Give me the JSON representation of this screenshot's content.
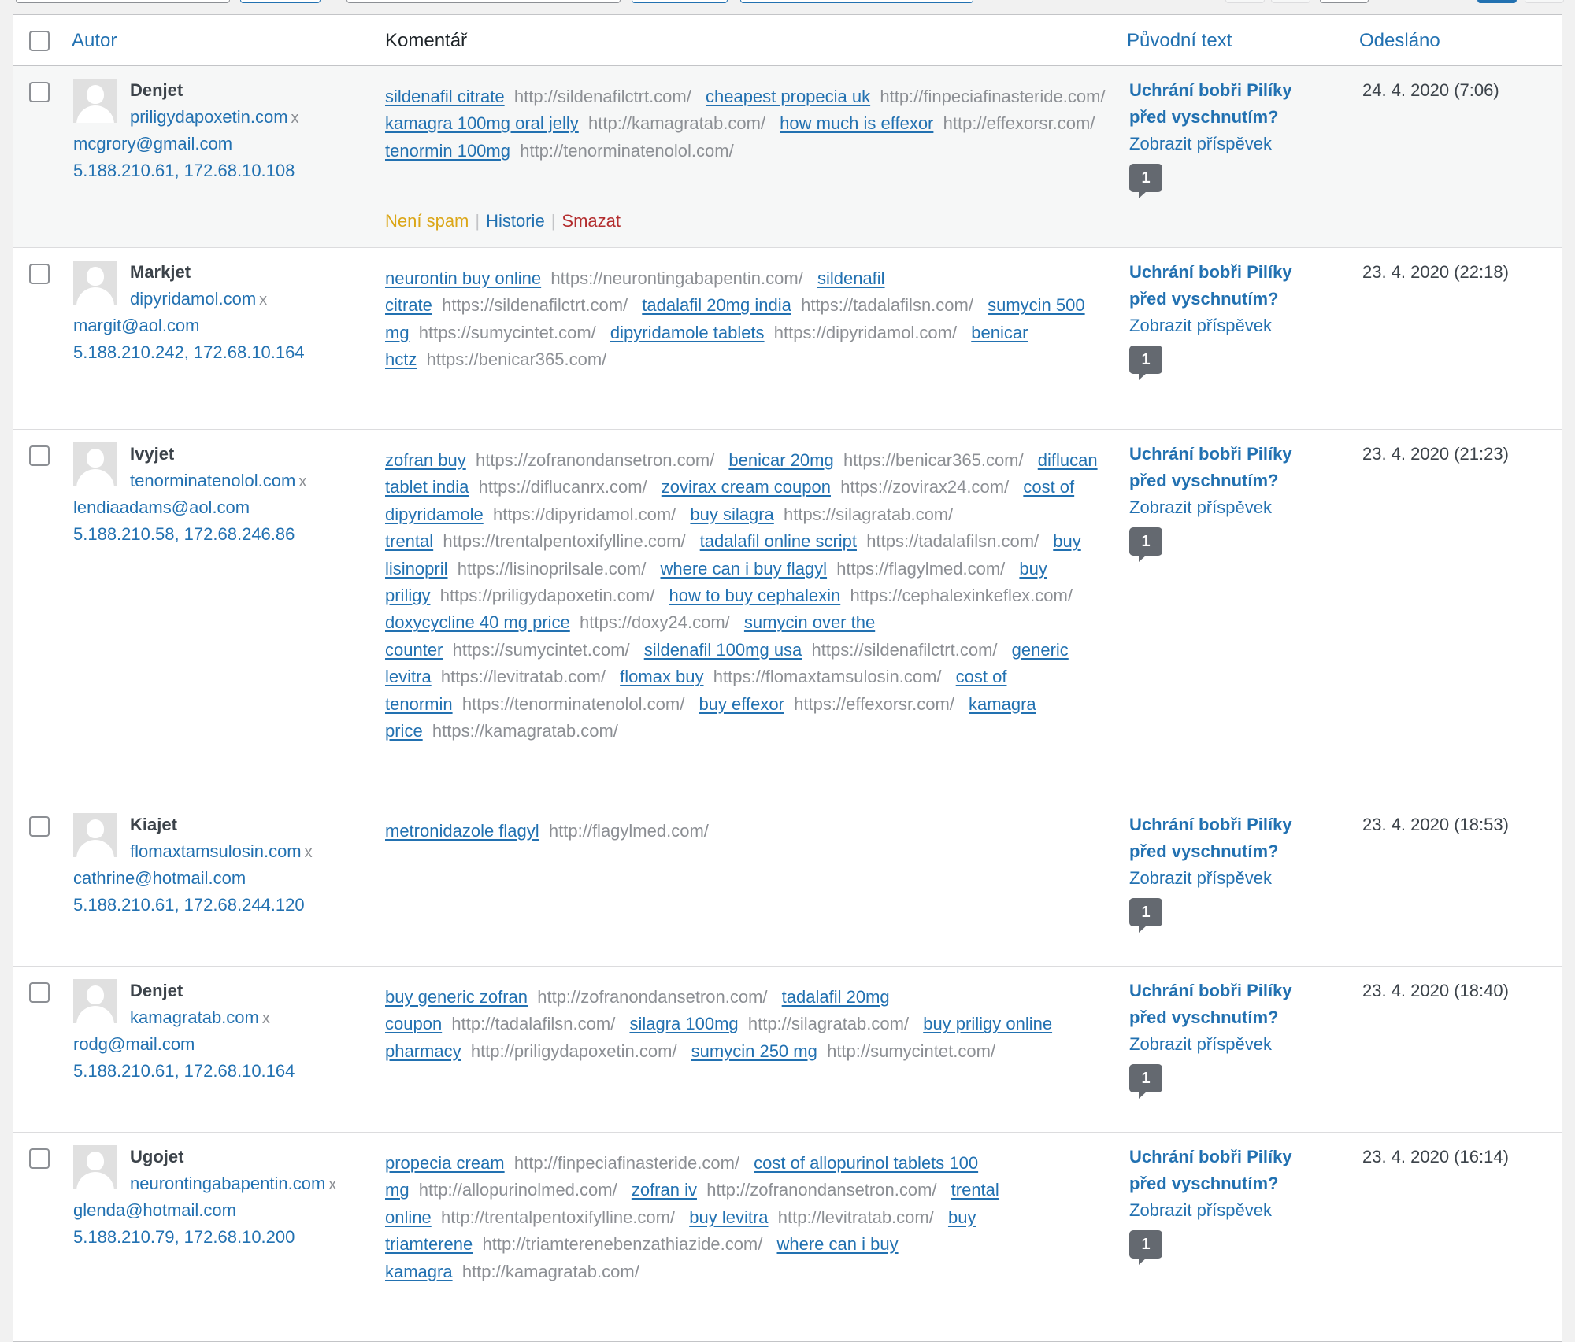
{
  "header": {
    "author": "Autor",
    "comment": "Komentář",
    "response": "Původní text",
    "submitted": "Odesláno"
  },
  "colors": {
    "link": "#2271b1",
    "not_spam": "#dba617",
    "delete": "#b32d2e",
    "url_text": "#8c8f94",
    "spam_row_bg": "#f6f7f7"
  },
  "rows": [
    {
      "name": "Denjet",
      "site": "priligydapoxetin.com",
      "email": "mcgrory@gmail.com",
      "ip": "5.188.210.61, 172.68.10.108",
      "post": "Uchrání bobři Pilíky před vyschnutím?",
      "view": "Zobrazit příspěvek",
      "count": "1",
      "date": "24. 4. 2020 (7:06)",
      "actions": {
        "not_spam": "Není spam",
        "history": "Historie",
        "delete": "Smazat"
      },
      "segments": [
        {
          "t": "sildenafil citrate",
          "u": "http://sildenafilctrt.com/"
        },
        {
          "t": "cheapest propecia uk",
          "u": "http://finpeciafinasteride.com/"
        },
        {
          "t": "kamagra 100mg oral jelly",
          "u": "http://kamagratab.com/"
        },
        {
          "t": "how much is effexor",
          "u": "http://effexorsr.com/"
        },
        {
          "t": "tenormin 100mg",
          "u": "http://tenorminatenolol.com/"
        }
      ]
    },
    {
      "name": "Markjet",
      "site": "dipyridamol.com",
      "email": "margit@aol.com",
      "ip": "5.188.210.242, 172.68.10.164",
      "post": "Uchrání bobři Pilíky před vyschnutím?",
      "view": "Zobrazit příspěvek",
      "count": "1",
      "date": "23. 4. 2020 (22:18)",
      "segments": [
        {
          "t": "neurontin buy online",
          "u": "https://neurontingabapentin.com/"
        },
        {
          "t": "sildenafil citrate",
          "u": "https://sildenafilctrt.com/"
        },
        {
          "t": "tadalafil 20mg india",
          "u": "https://tadalafilsn.com/"
        },
        {
          "t": "sumycin 500 mg",
          "u": "https://sumycintet.com/"
        },
        {
          "t": "dipyridamole tablets",
          "u": "https://dipyridamol.com/"
        },
        {
          "t": "benicar hctz",
          "u": "https://benicar365.com/"
        }
      ]
    },
    {
      "name": "Ivyjet",
      "site": "tenorminatenolol.com",
      "email": "lendiaadams@aol.com",
      "ip": "5.188.210.58, 172.68.246.86",
      "post": "Uchrání bobři Pilíky před vyschnutím?",
      "view": "Zobrazit příspěvek",
      "count": "1",
      "date": "23. 4. 2020 (21:23)",
      "segments": [
        {
          "t": "zofran buy",
          "u": "https://zofranondansetron.com/"
        },
        {
          "t": "benicar 20mg",
          "u": "https://benicar365.com/"
        },
        {
          "t": "diflucan tablet india",
          "u": "https://diflucanrx.com/"
        },
        {
          "t": "zovirax cream coupon",
          "u": "https://zovirax24.com/"
        },
        {
          "t": "cost of dipyridamole",
          "u": "https://dipyridamol.com/"
        },
        {
          "t": "buy silagra",
          "u": "https://silagratab.com/"
        },
        {
          "t": "trental",
          "u": "https://trentalpentoxifylline.com/"
        },
        {
          "t": "tadalafil online script",
          "u": "https://tadalafilsn.com/"
        },
        {
          "t": "buy lisinopril",
          "u": "https://lisinoprilsale.com/"
        },
        {
          "t": "where can i buy flagyl",
          "u": "https://flagylmed.com/"
        },
        {
          "t": "buy priligy",
          "u": "https://priligydapoxetin.com/"
        },
        {
          "t": "how to buy cephalexin",
          "u": "https://cephalexinkeflex.com/"
        },
        {
          "t": "doxycycline 40 mg price",
          "u": "https://doxy24.com/"
        },
        {
          "t": "sumycin over the counter",
          "u": "https://sumycintet.com/"
        },
        {
          "t": "sildenafil 100mg usa",
          "u": "https://sildenafilctrt.com/"
        },
        {
          "t": "generic levitra",
          "u": "https://levitratab.com/"
        },
        {
          "t": "flomax buy",
          "u": "https://flomaxtamsulosin.com/"
        },
        {
          "t": "cost of tenormin",
          "u": "https://tenorminatenolol.com/"
        },
        {
          "t": "buy effexor",
          "u": "https://effexorsr.com/"
        },
        {
          "t": "kamagra price",
          "u": "https://kamagratab.com/"
        }
      ]
    },
    {
      "name": "Kiajet",
      "site": "flomaxtamsulosin.com",
      "email": "cathrine@hotmail.com",
      "ip": "5.188.210.61, 172.68.244.120",
      "post": "Uchrání bobři Pilíky před vyschnutím?",
      "view": "Zobrazit příspěvek",
      "count": "1",
      "date": "23. 4. 2020 (18:53)",
      "segments": [
        {
          "t": "metronidazole flagyl",
          "u": "http://flagylmed.com/"
        }
      ]
    },
    {
      "name": "Denjet",
      "site": "kamagratab.com",
      "email": "rodg@mail.com",
      "ip": "5.188.210.61, 172.68.10.164",
      "post": "Uchrání bobři Pilíky před vyschnutím?",
      "view": "Zobrazit příspěvek",
      "count": "1",
      "date": "23. 4. 2020 (18:40)",
      "segments": [
        {
          "t": "buy generic zofran",
          "u": "http://zofranondansetron.com/"
        },
        {
          "t": "tadalafil 20mg coupon",
          "u": "http://tadalafilsn.com/"
        },
        {
          "t": "silagra 100mg",
          "u": "http://silagratab.com/"
        },
        {
          "t": "buy priligy online pharmacy",
          "u": "http://priligydapoxetin.com/"
        },
        {
          "t": "sumycin 250 mg",
          "u": "http://sumycintet.com/"
        }
      ]
    },
    {
      "name": "Ugojet",
      "site": "neurontingabapentin.com",
      "email": "glenda@hotmail.com",
      "ip": "5.188.210.79, 172.68.10.200",
      "post": "Uchrání bobři Pilíky před vyschnutím?",
      "view": "Zobrazit příspěvek",
      "count": "1",
      "date": "23. 4. 2020 (16:14)",
      "segments": [
        {
          "t": "propecia cream",
          "u": "http://finpeciafinasteride.com/"
        },
        {
          "t": "cost of allopurinol tablets 100 mg",
          "u": "http://allopurinolmed.com/"
        },
        {
          "t": "zofran iv",
          "u": "http://zofranondansetron.com/"
        },
        {
          "t": "trental online",
          "u": "http://trentalpentoxifylline.com/"
        },
        {
          "t": "buy levitra",
          "u": "http://levitratab.com/"
        },
        {
          "t": "buy triamterene",
          "u": "http://triamterenebenzathiazide.com/"
        },
        {
          "t": "where can i buy kamagra",
          "u": "http://kamagratab.com/"
        }
      ]
    }
  ]
}
